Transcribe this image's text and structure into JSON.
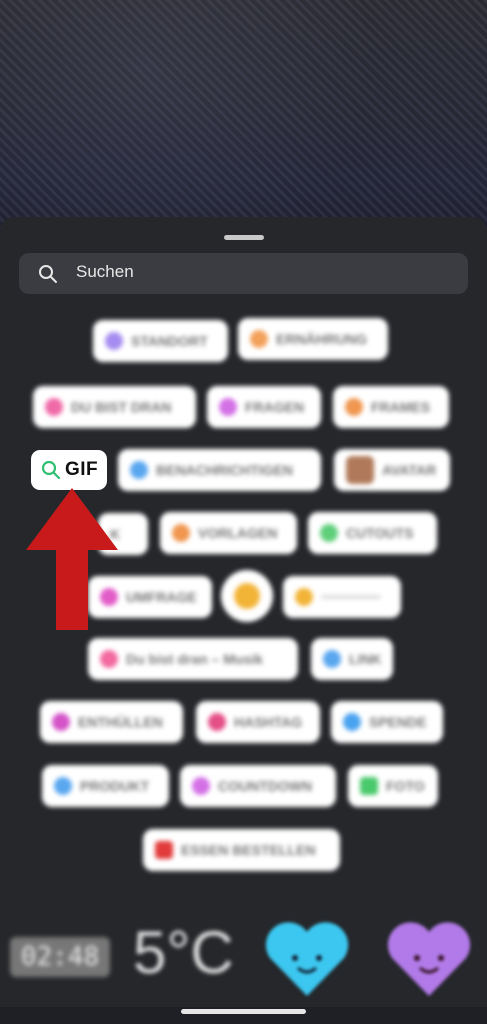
{
  "search": {
    "placeholder": "Suchen"
  },
  "stickers": [
    {
      "label": "STANDORT",
      "color": "#a58cf0"
    },
    {
      "label": "ERNÄHRUNG",
      "color": "#f3a15b"
    },
    {
      "label": "DU BIST DRAN",
      "color": "#f06aa8"
    },
    {
      "label": "FRAGEN",
      "color": "#d470e6"
    },
    {
      "label": "FRAMES",
      "color": "#f0964f"
    },
    {
      "label": "GIF",
      "color": "#2fbf71"
    },
    {
      "label": "BENACHRICHTIGEN",
      "color": "#5aa7f0"
    },
    {
      "label": "AVATAR",
      "color": "#b07a5a"
    },
    {
      "label": "K",
      "color": "#999999"
    },
    {
      "label": "VORLAGEN",
      "color": "#f0964f"
    },
    {
      "label": "CUTOUTS",
      "color": "#5fcf7a"
    },
    {
      "label": "UMFRAGE",
      "color": "#e25cc7"
    },
    {
      "label": "LINK",
      "color": "#5aa7f0"
    },
    {
      "label": "Du bist dran – Musik",
      "color": "#f26aa0"
    },
    {
      "label": "ENTHÜLLEN",
      "color": "#d454c8"
    },
    {
      "label": "HASHTAG",
      "color": "#e44f86"
    },
    {
      "label": "SPENDE",
      "color": "#4aa3f0"
    },
    {
      "label": "PRODUKT",
      "color": "#5aa7f0"
    },
    {
      "label": "COUNTDOWN",
      "color": "#d470e6"
    },
    {
      "label": "FOTO",
      "color": "#49c96b"
    },
    {
      "label": "ESSEN BESTELLEN",
      "color": "#e23b3b"
    }
  ],
  "bottom": {
    "clock": "02:48",
    "temperature": "5°C"
  },
  "colors": {
    "arrow": "#c81a1a",
    "heart_blue": "#3cc7f0",
    "heart_purple": "#b27ae8"
  }
}
